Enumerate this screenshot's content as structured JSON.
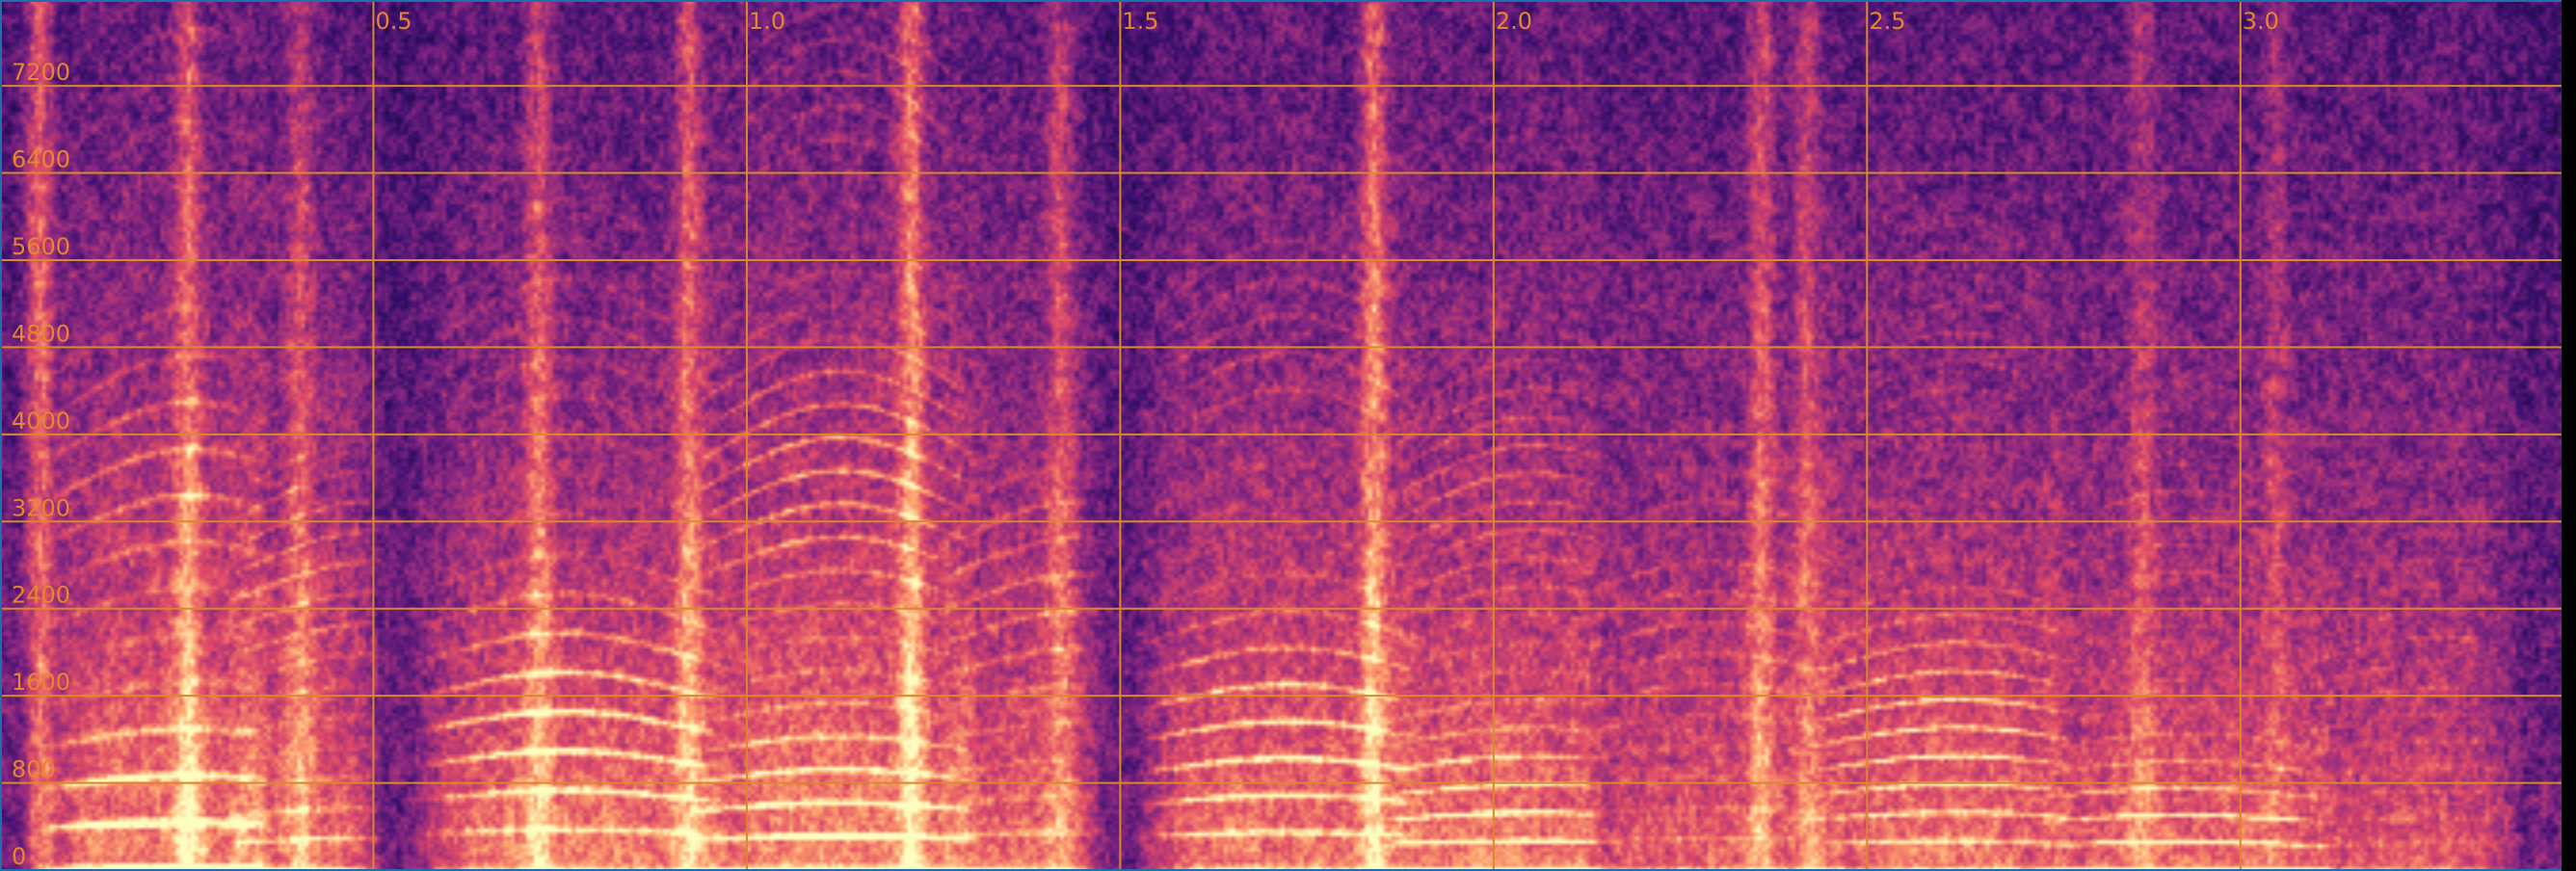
{
  "chart_data": {
    "type": "heatmap",
    "title": "",
    "xlabel": "",
    "ylabel": "",
    "x_ticks": [
      "0.5",
      "1.0",
      "1.5",
      "2.0",
      "2.5",
      "3.0"
    ],
    "y_ticks": [
      "0",
      "800",
      "1600",
      "2400",
      "3200",
      "4000",
      "4800",
      "5600",
      "6400",
      "7200"
    ],
    "xlim": [
      0,
      3.43
    ],
    "ylim": [
      0,
      7900
    ],
    "grid": true,
    "colormap": [
      "#0d0826",
      "#3b0f70",
      "#8c2981",
      "#de4968",
      "#fe9f6d",
      "#fcfdbf"
    ],
    "grid_color": "#d9882a",
    "label_color": "#e8862a",
    "syllables": [
      {
        "t0": 0.08,
        "t1": 0.33,
        "pitch": 380,
        "peak": 1.0,
        "reach": 3400
      },
      {
        "t0": 0.33,
        "t1": 0.48,
        "pitch": 250,
        "peak": 0.75,
        "reach": 2800
      },
      {
        "t0": 0.58,
        "t1": 0.95,
        "pitch": 320,
        "peak": 0.95,
        "reach": 2600
      },
      {
        "t0": 0.95,
        "t1": 1.28,
        "pitch": 270,
        "peak": 1.0,
        "reach": 4300
      },
      {
        "t0": 1.28,
        "t1": 1.45,
        "pitch": 300,
        "peak": 0.7,
        "reach": 2800
      },
      {
        "t0": 1.55,
        "t1": 1.88,
        "pitch": 300,
        "peak": 0.85,
        "reach": 3000
      },
      {
        "t0": 1.88,
        "t1": 2.12,
        "pitch": 230,
        "peak": 0.9,
        "reach": 3000
      },
      {
        "t0": 2.12,
        "t1": 2.45,
        "pitch": 250,
        "peak": 0.55,
        "reach": 2000
      },
      {
        "t0": 2.45,
        "t1": 2.75,
        "pitch": 230,
        "peak": 0.85,
        "reach": 2600
      },
      {
        "t0": 2.75,
        "t1": 3.1,
        "pitch": 220,
        "peak": 0.75,
        "reach": 1800
      },
      {
        "t0": 3.1,
        "t1": 3.35,
        "pitch": 210,
        "peak": 0.5,
        "reach": 1500
      }
    ],
    "bursts": [
      {
        "t": 0.05,
        "strength": 0.8
      },
      {
        "t": 0.25,
        "strength": 0.6
      },
      {
        "t": 0.4,
        "strength": 0.45
      },
      {
        "t": 0.72,
        "strength": 0.55
      },
      {
        "t": 0.92,
        "strength": 0.65
      },
      {
        "t": 1.22,
        "strength": 0.7
      },
      {
        "t": 1.42,
        "strength": 0.45
      },
      {
        "t": 1.84,
        "strength": 0.75
      },
      {
        "t": 2.36,
        "strength": 0.55
      },
      {
        "t": 2.42,
        "strength": 0.5
      },
      {
        "t": 2.87,
        "strength": 0.35
      },
      {
        "t": 3.05,
        "strength": 0.3
      }
    ]
  }
}
